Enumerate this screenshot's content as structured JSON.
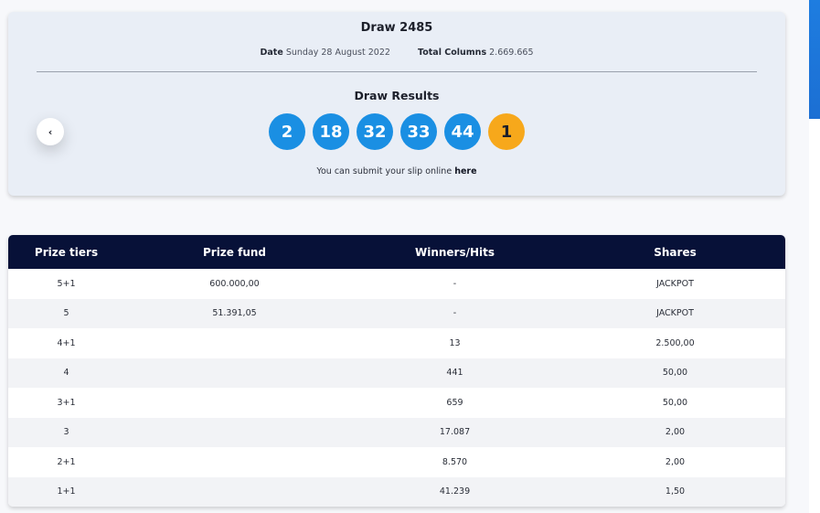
{
  "draw": {
    "title": "Draw 2485",
    "date_label": "Date",
    "date_value": "Sunday 28 August 2022",
    "columns_label": "Total Columns",
    "columns_value": "2.669.665",
    "results_title": "Draw Results",
    "numbers": [
      "2",
      "18",
      "32",
      "33",
      "44"
    ],
    "bonus": "1",
    "prev_symbol": "‹",
    "submit_text": "You can submit your slip online",
    "submit_link": "here"
  },
  "colors": {
    "ball": "#1a8fe3",
    "bonus_ball": "#f7a81b",
    "table_header": "#071138"
  },
  "table": {
    "headers": [
      "Prize tiers",
      "Prize fund",
      "Winners/Hits",
      "Shares"
    ],
    "rows": [
      [
        "5+1",
        "600.000,00",
        "-",
        "JACKPOT"
      ],
      [
        "5",
        "51.391,05",
        "-",
        "JACKPOT"
      ],
      [
        "4+1",
        "",
        "13",
        "2.500,00"
      ],
      [
        "4",
        "",
        "441",
        "50,00"
      ],
      [
        "3+1",
        "",
        "659",
        "50,00"
      ],
      [
        "3",
        "",
        "17.087",
        "2,00"
      ],
      [
        "2+1",
        "",
        "8.570",
        "2,00"
      ],
      [
        "1+1",
        "",
        "41.239",
        "1,50"
      ]
    ]
  }
}
